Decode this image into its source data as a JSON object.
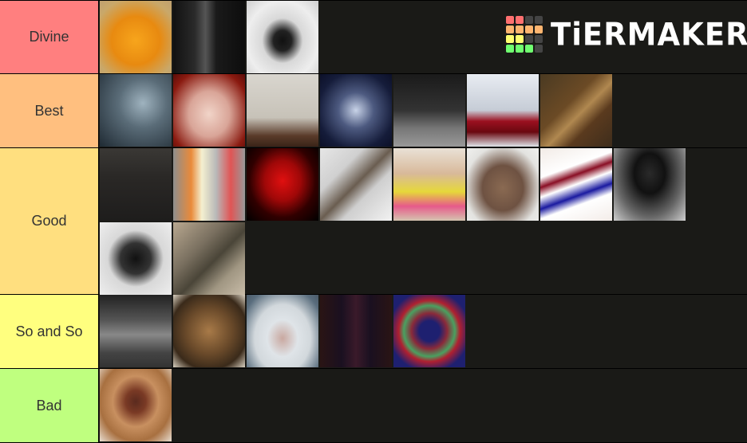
{
  "logo": {
    "text": "TiERMAKER",
    "grid_colors": [
      "#ff7070",
      "#ff7070",
      "#444444",
      "#444444",
      "#ffb570",
      "#ffb570",
      "#ffb570",
      "#ffb570",
      "#ffff70",
      "#ffff70",
      "#444444",
      "#444444",
      "#70ff70",
      "#70ff70",
      "#70ff70",
      "#444444"
    ]
  },
  "tiers": [
    {
      "label": "Divine",
      "color": "#ff7f7f",
      "items": [
        {
          "name": "orange-blob-creature",
          "bg": "radial-gradient(circle at 50% 55%, #f7a51c 0%, #e88a10 45%, #c9a86a 80%, #bfa070 100%)"
        },
        {
          "name": "dark-doorway-skull-figure",
          "bg": "linear-gradient(90deg, #111 0%, #2a2a2a 30%, #555 45%, #1a1a1a 60%, #0d0d0d 100%)"
        },
        {
          "name": "shadow-figure-in-snow",
          "bg": "radial-gradient(ellipse at 50% 55%, #111 0%, #222 18%, #d8d8d8 40%, #eeeeee 70%, #cfcfcf 100%)"
        }
      ]
    },
    {
      "label": "Best",
      "color": "#ffbf7f",
      "items": [
        {
          "name": "foggy-hooded-figures",
          "bg": "radial-gradient(ellipse at 60% 40%, #9fb3bf 0%, #5a6c78 40%, #1f2a33 100%)"
        },
        {
          "name": "crying-mask-face",
          "bg": "radial-gradient(ellipse at 50% 55%, #f1d4c8 0%, #d9a598 40%, #8a1a10 80%, #5a0c08 100%)"
        },
        {
          "name": "creature-in-room",
          "bg": "linear-gradient(180deg, #d9d6cf 0%, #c7c2b8 60%, #5a3b2a 85%, #3a2418 100%)"
        },
        {
          "name": "plague-doctor-mask",
          "bg": "radial-gradient(ellipse at 50% 50%, #c8d3e8 0%, #4d5a80 35%, #151c3a 75%, #0c1028 100%)"
        },
        {
          "name": "pale-crawling-figure",
          "bg": "linear-gradient(180deg, #1a1a1a 0%, #333 50%, #777 75%, #999 100%)"
        },
        {
          "name": "bloody-snow-forest",
          "bg": "linear-gradient(180deg, #e8ecf2 0%, #c6ccd6 50%, #9b1020 65%, #6a0810 80%, #dfe4ea 100%)"
        },
        {
          "name": "old-brass-key",
          "bg": "linear-gradient(135deg, #4a3a22 0%, #6b4a25 40%, #b08850 55%, #5a3a1e 70%, #3e2d1c 100%)"
        }
      ]
    },
    {
      "label": "Good",
      "color": "#ffdf7f",
      "items": [
        {
          "name": "dark-office-room",
          "bg": "linear-gradient(180deg, #3a3835 0%, #2a2826 40%, #1e1d1c 100%)"
        },
        {
          "name": "pill-bottle",
          "bg": "linear-gradient(90deg, #8e8e8e 0%, #e98a3a 25%, #f4f0d0 40%, #b8b8b8 60%, #e05555 80%, #999 100%)"
        },
        {
          "name": "red-demon-creature",
          "bg": "radial-gradient(ellipse at 50% 45%, #e01010 0%, #a00808 35%, #300000 65%, #000 100%)"
        },
        {
          "name": "cigarette-joint",
          "bg": "linear-gradient(135deg, #e6e6e6 0%, #d0d0d0 30%, #6a5d50 50%, #cfcfcf 65%, #f2f2f2 100%)"
        },
        {
          "name": "girl-in-floral-dress",
          "bg": "linear-gradient(180deg, #e9e1d6 0%, #d8b99a 35%, #e6d83a 60%, #e65a8a 80%, #d5c5b0 100%)"
        },
        {
          "name": "cowbell",
          "bg": "radial-gradient(ellipse at 50% 55%, #8a6a52 0%, #6e5242 40%, #e3e3e0 75%, #f0f0ee 100%)"
        },
        {
          "name": "3d-glasses",
          "bg": "linear-gradient(160deg, #f2ebe6 0%, #fff 30%, #8a0f25 40%, #fff 50%, #1a1aa0 62%, #fff 72%, #f3ece8 100%)"
        },
        {
          "name": "dark-tunnel-wolf",
          "bg": "radial-gradient(ellipse at 50% 35%, #2a2a2a 0%, #111 30%, #666 65%, #cfcfcf 100%)"
        },
        {
          "name": "dark-face-portrait",
          "bg": "radial-gradient(ellipse at 50% 50%, #111 0%, #333 30%, #d8d8d8 55%, #eeeeee 100%)"
        },
        {
          "name": "decaying-reptile",
          "bg": "linear-gradient(135deg, #b9a890 0%, #7a7060 35%, #4a4538 55%, #a09682 75%, #c8bca8 100%)"
        }
      ]
    },
    {
      "label": "So and So",
      "color": "#ffff7f",
      "items": [
        {
          "name": "grainy-warehouse",
          "bg": "linear-gradient(180deg, #222 0%, #555 35%, #888 55%, #444 80%, #333 100%)"
        },
        {
          "name": "greek-vase",
          "bg": "radial-gradient(ellipse at 50% 50%, #a87a48 0%, #6a4a2a 45%, #3a2a1a 75%, #d8d0c0 100%)"
        },
        {
          "name": "toilet",
          "bg": "radial-gradient(ellipse at 50% 60%, #c9a8a0 0%, #dfe4e8 30%, #d2d8dc 55%, #5a6e7e 85%, #4a5a68 100%)"
        },
        {
          "name": "dark-double-doors",
          "bg": "linear-gradient(90deg, #2a1414 0%, #1a1020 30%, #3a1a2a 50%, #1a1020 70%, #2a1414 100%)"
        },
        {
          "name": "protein-molecule",
          "bg": "radial-gradient(circle at 50% 50%, #1e2070 0%, #1e2070 20%, #8a2a3a 35%, #4aa060 50%, #b02030 60%, #1e2070 80%)"
        }
      ]
    },
    {
      "label": "Bad",
      "color": "#bfff7f",
      "items": [
        {
          "name": "teddy-bear-bowtie",
          "bg": "radial-gradient(ellipse at 50% 45%, #5a2a1e 0%, #7a3a25 20%, #c89060 45%, #a87040 70%, #e8ddd0 100%)"
        }
      ]
    }
  ]
}
